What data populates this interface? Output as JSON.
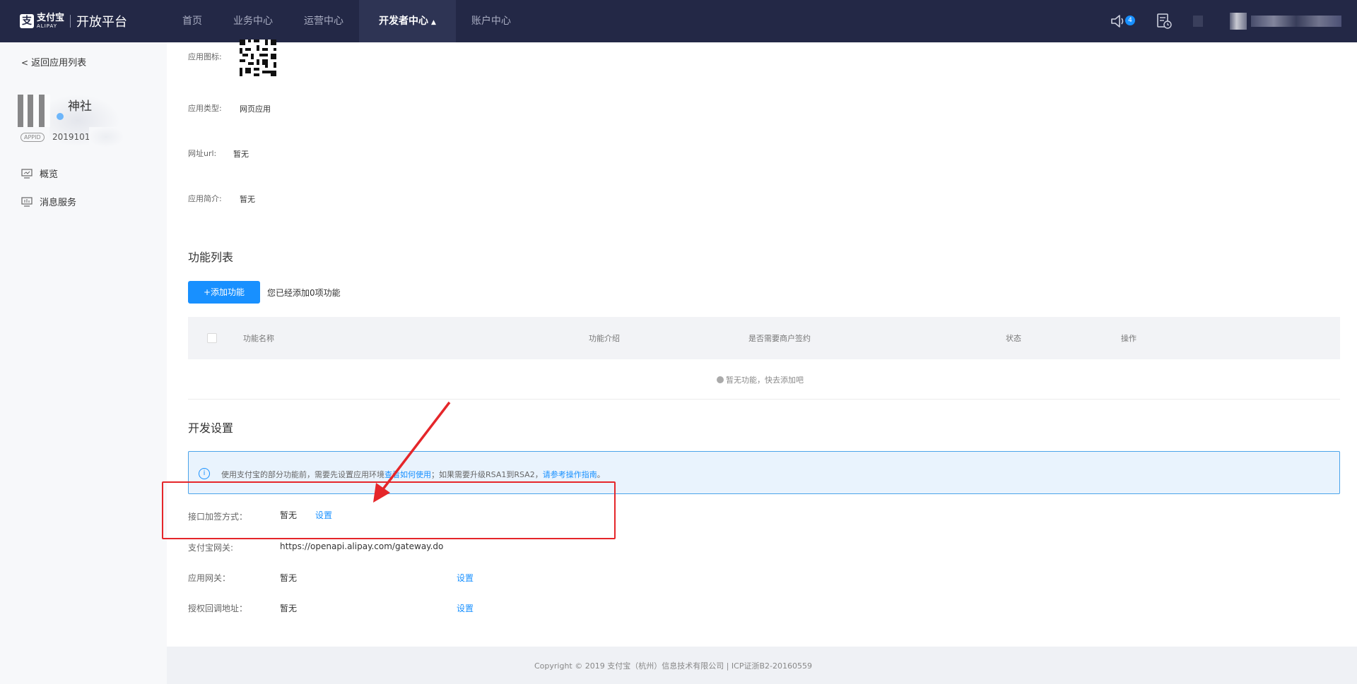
{
  "topbar": {
    "logo_cn": "支付宝",
    "logo_en": "ALIPAY",
    "platform": "开放平台",
    "nav": [
      "首页",
      "业务中心",
      "运营中心",
      "开发者中心",
      "账户中心"
    ],
    "active_caret": "▲",
    "notification_count": "4",
    "accent": "#1890ff"
  },
  "sidebar": {
    "back": "返回应用列表",
    "app_name": "神社",
    "appid_tag": "APPID",
    "appid_value": "2019101",
    "items": [
      "概览",
      "消息服务"
    ]
  },
  "app_info": {
    "icon_label": "应用图标:",
    "type_label": "应用类型:",
    "type_value": "网页应用",
    "url_label": "网址url:",
    "url_value": "暂无",
    "intro_label": "应用简介:",
    "intro_value": "暂无"
  },
  "functions": {
    "title": "功能列表",
    "add_button": "+添加功能",
    "note": "您已经添加0项功能",
    "columns": [
      "功能名称",
      "功能介绍",
      "是否需要商户签约",
      "状态",
      "操作"
    ],
    "empty": "暂无功能，快去添加吧"
  },
  "dev_settings": {
    "title": "开发设置",
    "alert_icon": "i",
    "alert_prefix": "使用支付宝的部分功能前，需要先设置应用环境",
    "alert_link1": "查看如何使用",
    "alert_middle": "；如果需要升级RSA1到RSA2，",
    "alert_link2": "请参考操作指南",
    "alert_suffix": "。",
    "rows": [
      {
        "label": "接口加签方式：",
        "value": "暂无",
        "action": "设置"
      },
      {
        "label": "支付宝网关:",
        "value": "https://openapi.alipay.com/gateway.do",
        "action": ""
      },
      {
        "label": "应用网关：",
        "value": "暂无",
        "action": "设置"
      },
      {
        "label": "授权回调地址：",
        "value": "暂无",
        "action": "设置"
      }
    ]
  },
  "footer": {
    "text": "Copyright © 2019 支付宝（杭州）信息技术有限公司 | ICP证浙B2-20160559"
  },
  "annotation_color": "#e5262a"
}
